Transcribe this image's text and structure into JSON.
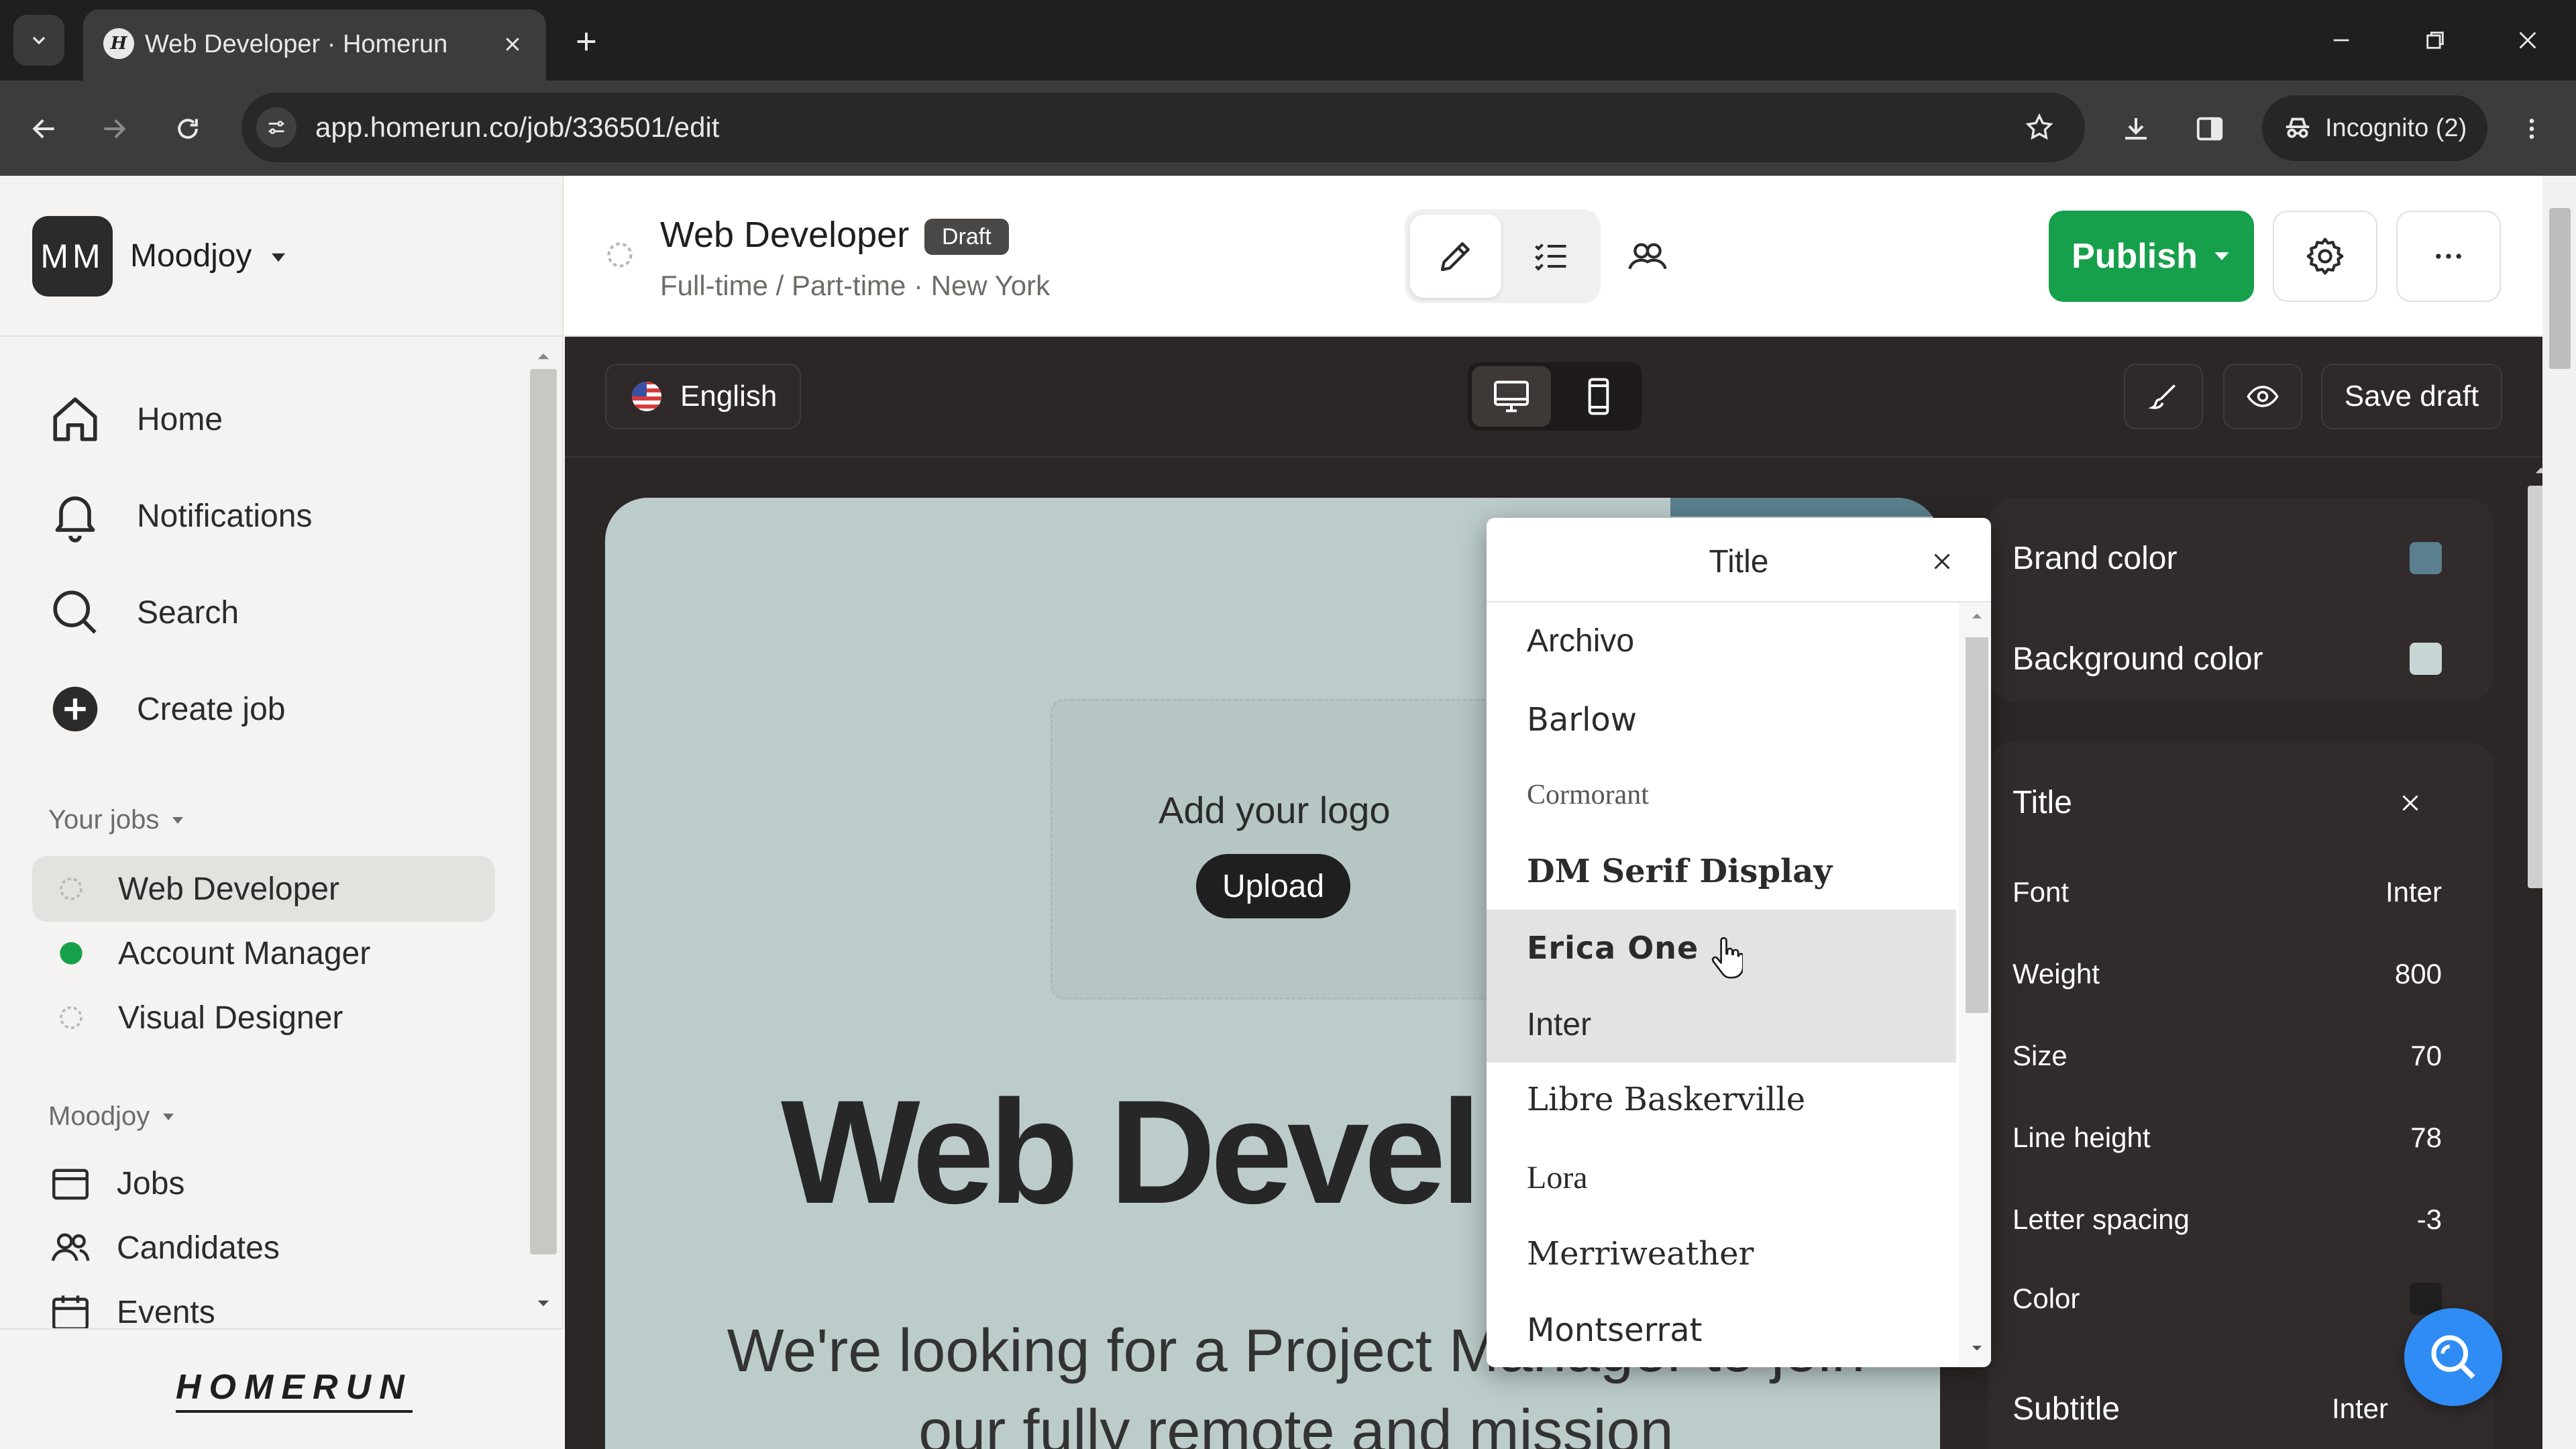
{
  "browser": {
    "tab_title": "Web Developer · Homerun",
    "url": "app.homerun.co/job/336501/edit",
    "incognito_label": "Incognito (2)"
  },
  "sidebar": {
    "workspace_initials": "MM",
    "workspace_name": "Moodjoy",
    "nav": [
      {
        "label": "Home",
        "icon": "home-icon"
      },
      {
        "label": "Notifications",
        "icon": "bell-icon"
      },
      {
        "label": "Search",
        "icon": "search-icon"
      },
      {
        "label": "Create job",
        "icon": "plus-circle-icon"
      }
    ],
    "your_jobs_label": "Your jobs",
    "jobs": [
      {
        "label": "Web Developer",
        "status": "draft",
        "status_color": "#b9b7b4"
      },
      {
        "label": "Account Manager",
        "status": "published",
        "status_color": "#17a04b"
      },
      {
        "label": "Visual Designer",
        "status": "draft",
        "status_color": "#b9b7b4"
      }
    ],
    "workspace_section_label": "Moodjoy",
    "workspace_nav": [
      {
        "label": "Jobs",
        "icon": "jobs-icon"
      },
      {
        "label": "Candidates",
        "icon": "candidates-icon"
      },
      {
        "label": "Events",
        "icon": "calendar-icon"
      }
    ],
    "brand": "HOMERUN"
  },
  "job_header": {
    "title": "Web Developer",
    "badge": "Draft",
    "meta": "Full-time / Part-time · New York",
    "modes": [
      "edit-icon",
      "checklist-icon",
      "people-icon"
    ],
    "publish_label": "Publish",
    "publish_color": "#17a04b"
  },
  "editor_toolbar": {
    "language": "English",
    "save_draft_label": "Save draft"
  },
  "preview": {
    "logo_prompt": "Add your logo",
    "upload_label": "Upload",
    "title_text": "Web Devel",
    "body_text": "We're looking for a Project Manager to join our fully remote and mission",
    "background_color": "#bccccb"
  },
  "font_dropdown": {
    "title": "Title",
    "options": [
      {
        "label": "Archivo",
        "family": "\"Liberation Sans\", sans-serif",
        "weight": "normal"
      },
      {
        "label": "Barlow",
        "family": "\"DejaVu Sans\", sans-serif",
        "weight": "normal"
      },
      {
        "label": "Cormorant",
        "family": "\"Liberation Serif\", serif",
        "weight": "normal"
      },
      {
        "label": "DM Serif Display",
        "family": "\"DejaVu Serif\", serif",
        "weight": "bold"
      },
      {
        "label": "Erica One",
        "family": "\"DejaVu Sans\", sans-serif",
        "weight": "bold"
      },
      {
        "label": "Inter",
        "family": "\"Liberation Sans\", sans-serif",
        "weight": "normal"
      },
      {
        "label": "Libre Baskerville",
        "family": "\"DejaVu Serif\", serif",
        "weight": "normal"
      },
      {
        "label": "Lora",
        "family": "\"Liberation Serif\", serif",
        "weight": "normal"
      },
      {
        "label": "Merriweather",
        "family": "\"DejaVu Serif\", serif",
        "weight": "normal"
      },
      {
        "label": "Montserrat",
        "family": "\"DejaVu Sans\", sans-serif",
        "weight": "normal"
      }
    ]
  },
  "style_panel": {
    "brand_color_label": "Brand color",
    "brand_color": "#5a7f8e",
    "background_color_label": "Background color",
    "background_color": "#c7d6d5",
    "title_section": "Title",
    "props": [
      {
        "label": "Font",
        "value": "Inter"
      },
      {
        "label": "Weight",
        "value": "800"
      },
      {
        "label": "Size",
        "value": "70"
      },
      {
        "label": "Line height",
        "value": "78"
      },
      {
        "label": "Letter spacing",
        "value": "-3"
      }
    ],
    "color_label": "Color",
    "title_color": "#1f1f1f",
    "subtitle_section": "Subtitle",
    "subtitle_font": "Inter"
  }
}
